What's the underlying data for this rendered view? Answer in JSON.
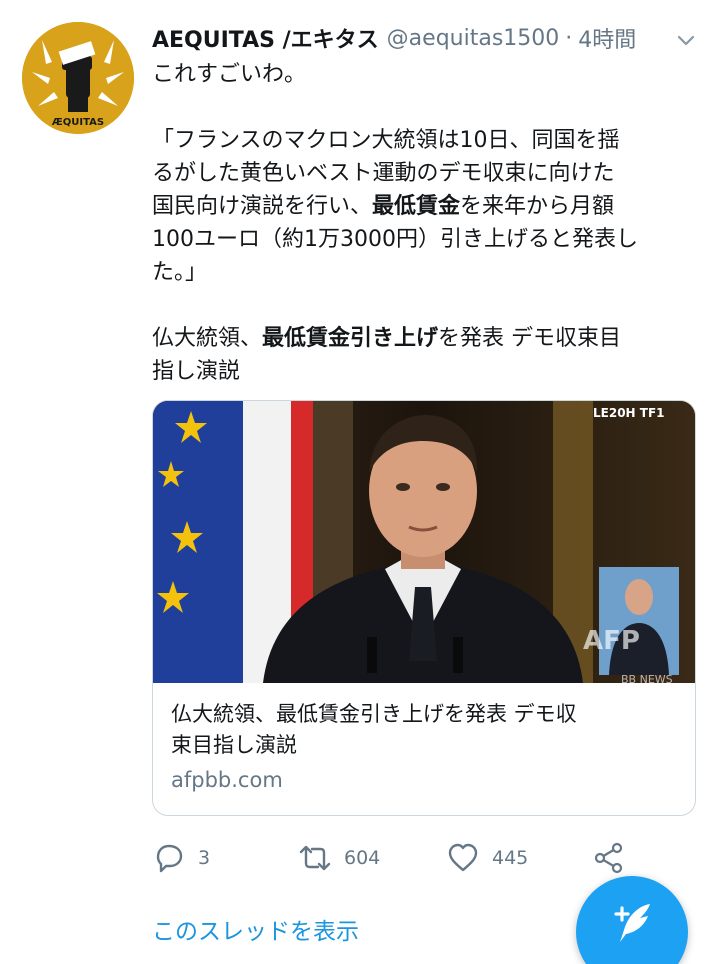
{
  "tweet": {
    "display_name": "AEQUITAS /エキタス",
    "handle": "@aequitas1500",
    "separator": "·",
    "time": "4時間",
    "avatar_label": "ÆQUITAS",
    "body": {
      "line1": "これすごいわ。",
      "quote_l1": "「フランスのマクロン大統領は10日、同国を揺",
      "quote_l2": "るがした黄色いベスト運動のデモ収束に向けた",
      "quote_l3_pre": "国民向け演説を行い、",
      "quote_l3_bold": "最低賃金",
      "quote_l3_post": "を来年から月額",
      "quote_l4": "100ユーロ（約1万3000円）引き上げると発表し",
      "quote_l5": "た。」",
      "headline_pre": "仏大統領、",
      "headline_bold": "最低賃金引き上げ",
      "headline_post": "を発表 デモ収束目",
      "headline_l2": "指し演説"
    }
  },
  "card": {
    "title_l1": "仏大統領、最低賃金引き上げを発表 デモ収",
    "title_l2": "束目指し演説",
    "domain": "afpbb.com",
    "image_tv_logo": "LE20H TF1",
    "image_watermark": "AFP",
    "image_news": "BB NEWS"
  },
  "actions": {
    "reply_count": "3",
    "retweet_count": "604",
    "like_count": "445"
  },
  "thread_link": "このスレッドを表示",
  "colors": {
    "accent": "#1da1f2",
    "link": "#1b95e0",
    "secondary_text": "#657786",
    "avatar_bg": "#d9a21b"
  },
  "icons": {
    "reply": "reply-icon",
    "retweet": "retweet-icon",
    "like": "heart-icon",
    "share": "share-icon",
    "menu": "chevron-down-icon",
    "compose": "compose-tweet-icon"
  }
}
